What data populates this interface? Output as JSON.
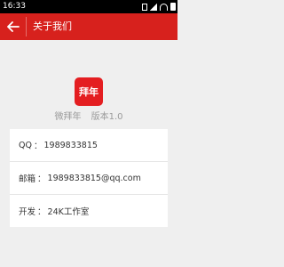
{
  "status_bar": {
    "time": "16:33",
    "icons": [
      "sim-icon",
      "signal-icon",
      "wifi-icon",
      "battery-icon"
    ]
  },
  "app_bar": {
    "title": "关于我们",
    "back_icon": "back-arrow-icon",
    "background_color": "#d7211d"
  },
  "app_info": {
    "logo_text": "拜年",
    "name": "微拜年",
    "version": "版本1.0",
    "logo_color": "#e41e21"
  },
  "contact": [
    {
      "label": "QQ",
      "value": "1989833815"
    },
    {
      "label": "邮箱",
      "value": "1989833815@qq.com"
    },
    {
      "label": "开发",
      "value": "24K工作室"
    }
  ],
  "colors": {
    "accent": "#d7211d",
    "background": "#efefef"
  }
}
